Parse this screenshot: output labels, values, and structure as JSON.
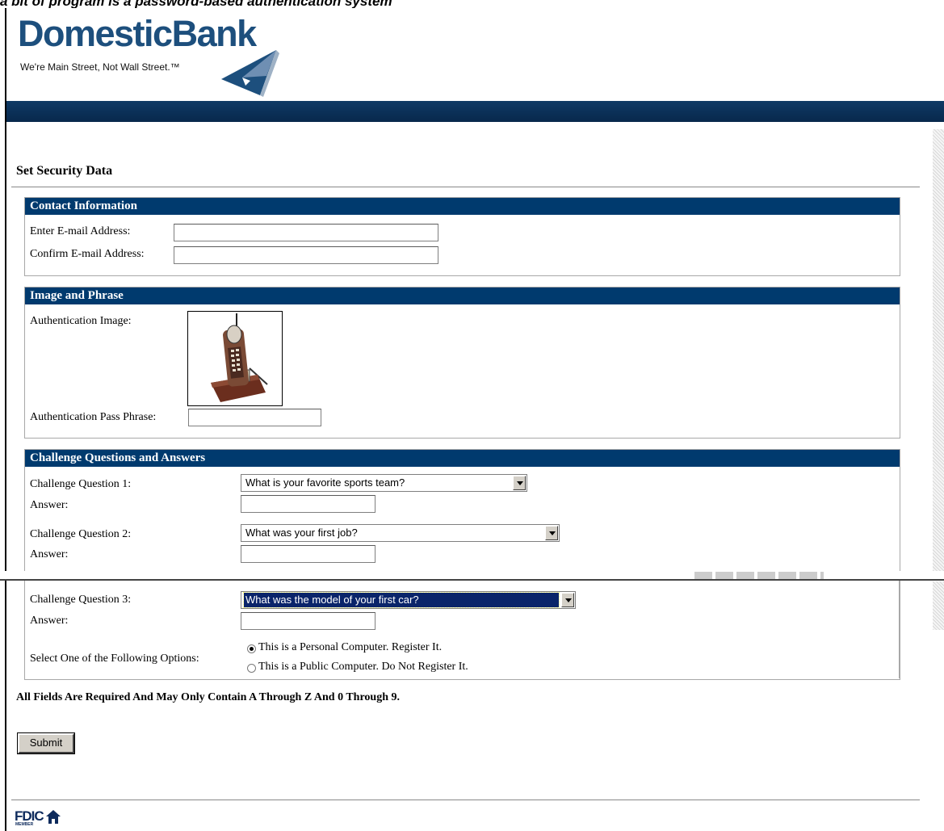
{
  "page_caption": "a bit of program is a password-based authentication system",
  "header": {
    "brand_name": "DomesticBank",
    "tagline": "We're Main Street, Not Wall Street.™"
  },
  "page_title": "Set Security Data",
  "contact": {
    "heading": "Contact Information",
    "email_label": "Enter E-mail Address:",
    "email_value": "",
    "confirm_label": "Confirm E-mail Address:",
    "confirm_value": ""
  },
  "image_phrase": {
    "heading": "Image and Phrase",
    "image_label": "Authentication Image:",
    "image_icon": "cordless-phone-image",
    "phrase_label": "Authentication Pass Phrase:",
    "phrase_value": ""
  },
  "challenge": {
    "heading": "Challenge Questions and Answers",
    "answer_label": "Answer:",
    "q1_label": "Challenge Question 1:",
    "q1_selected": "What is your favorite sports team?",
    "q1_answer": "",
    "q2_label": "Challenge Question 2:",
    "q2_selected": "What was your first job?",
    "q2_answer": "",
    "q3_label": "Challenge Question 3:",
    "q3_selected": "What was the model of your first car?",
    "q3_answer": "",
    "options_label": "Select One of the Following Options:",
    "option_personal": "This is a Personal Computer. Register It.",
    "option_public": "This is a Public Computer. Do Not Register It.",
    "selected_option": "personal"
  },
  "notice": "All Fields Are Required And May Only Contain A Through Z And 0 Through 9.",
  "submit_label": "Submit",
  "footer": {
    "logo_text": "FDIC",
    "logo_sub": "MEMBER",
    "icon": "house-icon"
  },
  "colors": {
    "brand_blue": "#1d4f7d",
    "section_header": "#003a6e",
    "banner": "#0f3a66"
  }
}
